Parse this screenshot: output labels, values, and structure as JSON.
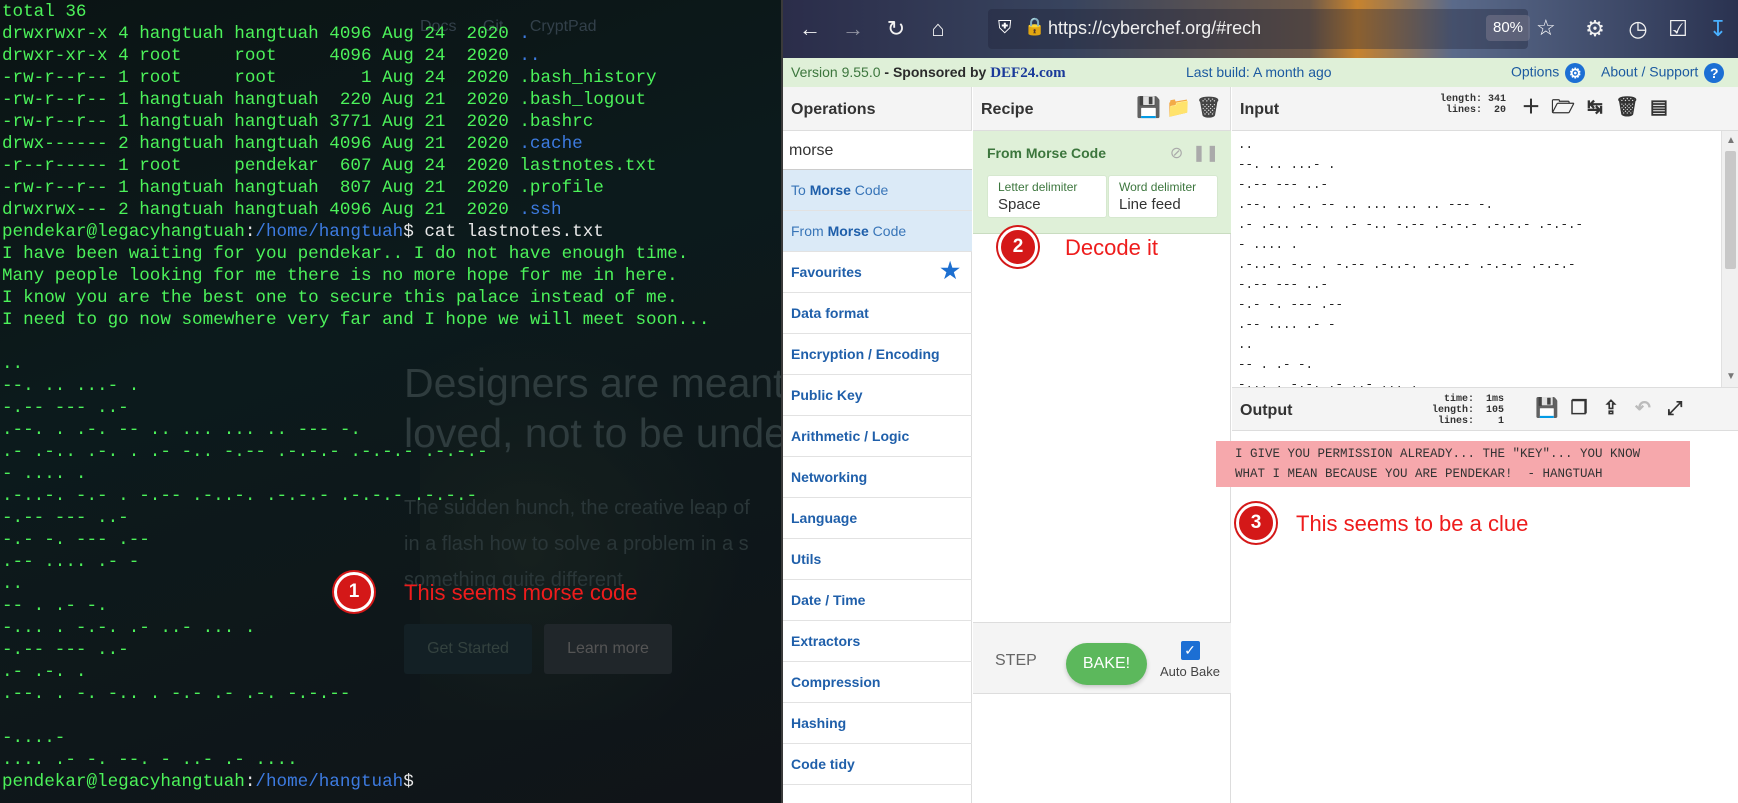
{
  "terminal": {
    "lines": [
      [
        {
          "t": "total 36",
          "c": "c-green"
        }
      ],
      [
        {
          "t": "drwxrwxr-x 4 hangtuah hangtuah 4096 Aug 24  2020 ",
          "c": "c-green"
        },
        {
          "t": ".",
          "c": "c-blue"
        }
      ],
      [
        {
          "t": "drwxr-xr-x 4 root     root     4096 Aug 24  2020 ",
          "c": "c-green"
        },
        {
          "t": "..",
          "c": "c-blue"
        }
      ],
      [
        {
          "t": "-rw-r--r-- 1 root     root        1 Aug 24  2020 .bash_history",
          "c": "c-green"
        }
      ],
      [
        {
          "t": "-rw-r--r-- 1 hangtuah hangtuah  220 Aug 21  2020 .bash_logout",
          "c": "c-green"
        }
      ],
      [
        {
          "t": "-rw-r--r-- 1 hangtuah hangtuah 3771 Aug 21  2020 .bashrc",
          "c": "c-green"
        }
      ],
      [
        {
          "t": "drwx------ 2 hangtuah hangtuah 4096 Aug 21  2020 ",
          "c": "c-green"
        },
        {
          "t": ".cache",
          "c": "c-blue"
        }
      ],
      [
        {
          "t": "-r--r----- 1 root     pendekar  607 Aug 24  2020 lastnotes.txt",
          "c": "c-green"
        }
      ],
      [
        {
          "t": "-rw-r--r-- 1 hangtuah hangtuah  807 Aug 21  2020 .profile",
          "c": "c-green"
        }
      ],
      [
        {
          "t": "drwxrwx--- 2 hangtuah hangtuah 4096 Aug 21  2020 ",
          "c": "c-green"
        },
        {
          "t": ".ssh",
          "c": "c-blue"
        }
      ],
      [
        {
          "t": "pendekar@legacyhangtuah",
          "c": "c-green"
        },
        {
          "t": ":",
          "c": "c-white"
        },
        {
          "t": "/home/hangtuah",
          "c": "c-blue"
        },
        {
          "t": "$ cat lastnotes.txt",
          "c": "c-white"
        }
      ],
      [
        {
          "t": "I have been waiting for you pendekar.. I do not have enough time.",
          "c": "c-green"
        }
      ],
      [
        {
          "t": "Many people looking for me there is no more hope for me in here.",
          "c": "c-green"
        }
      ],
      [
        {
          "t": "I know you are the best one to secure this palace instead of me.",
          "c": "c-green"
        }
      ],
      [
        {
          "t": "I need to go now somewhere very far and I hope we will meet soon...",
          "c": "c-green"
        }
      ],
      [
        {
          "t": "",
          "c": "c-green"
        }
      ],
      [
        {
          "t": "..",
          "c": "c-green"
        }
      ],
      [
        {
          "t": "--. .. ...- .",
          "c": "c-green"
        }
      ],
      [
        {
          "t": "-.-- --- ..-",
          "c": "c-green"
        }
      ],
      [
        {
          "t": ".--. . .-. -- .. ... ... .. --- -.",
          "c": "c-green"
        }
      ],
      [
        {
          "t": ".- .-.. .-. . .- -.. -.-- .-.-.- .-.-.- .-.-.-",
          "c": "c-green"
        }
      ],
      [
        {
          "t": "- .... .",
          "c": "c-green"
        }
      ],
      [
        {
          "t": ".-..-. -.- . -.-- .-..-. .-.-.- .-.-.- .-.-.-",
          "c": "c-green"
        }
      ],
      [
        {
          "t": "-.-- --- ..-",
          "c": "c-green"
        }
      ],
      [
        {
          "t": "-.- -. --- .--",
          "c": "c-green"
        }
      ],
      [
        {
          "t": ".-- .... .- -",
          "c": "c-green"
        }
      ],
      [
        {
          "t": "..",
          "c": "c-green"
        }
      ],
      [
        {
          "t": "-- . .- -.",
          "c": "c-green"
        }
      ],
      [
        {
          "t": "-... . -.-. .- ..- ... .",
          "c": "c-green"
        }
      ],
      [
        {
          "t": "-.-- --- ..-",
          "c": "c-green"
        }
      ],
      [
        {
          "t": ".- .-. .",
          "c": "c-green"
        }
      ],
      [
        {
          "t": ".--. . -. -.. . -.- .- .-. -.-.--",
          "c": "c-green"
        }
      ],
      [
        {
          "t": "",
          "c": "c-green"
        }
      ],
      [
        {
          "t": "-....-",
          "c": "c-green"
        }
      ],
      [
        {
          "t": ".... .- -. --. - ..- .- ....",
          "c": "c-green"
        }
      ],
      [
        {
          "t": "pendekar@legacyhangtuah",
          "c": "c-green"
        },
        {
          "t": ":",
          "c": "c-white"
        },
        {
          "t": "/home/hangtuah",
          "c": "c-blue"
        },
        {
          "t": "$ ",
          "c": "c-white"
        }
      ]
    ],
    "background": {
      "nav": [
        "Docs",
        "Git",
        "CryptPad"
      ],
      "headline_1": "Designers are meant t",
      "headline_2": "loved, not to be unders",
      "para_1": "The sudden hunch, the creative leap of",
      "para_2": "in a flash how to solve a problem in a s",
      "para_3": "something quite different",
      "btn_start": "Get Started",
      "btn_learn": "Learn more"
    },
    "annotation": {
      "number": "1",
      "text": "This seems morse code"
    }
  },
  "browser": {
    "url": "https://cyberchef.org/#rech",
    "zoom": "80%",
    "icons": {
      "back": "back-arrow-icon",
      "forward": "forward-arrow-icon",
      "reload": "reload-icon",
      "home": "home-icon",
      "shield": "shield-icon",
      "lock": "lock-icon",
      "star": "bookmark-star-icon"
    }
  },
  "cyberchef": {
    "version": "Version 9.55.0",
    "sponsor_prefix": " - Sponsored by ",
    "sponsor": "DEF24.com",
    "build": "Last build: A month ago",
    "options": "Options",
    "about": "About / Support",
    "operations": {
      "title": "Operations",
      "search_value": "morse",
      "results": [
        {
          "pre": "To ",
          "bold": "Morse",
          "post": " Code"
        },
        {
          "pre": "From ",
          "bold": "Morse",
          "post": " Code"
        }
      ],
      "categories": [
        "Favourites",
        "Data format",
        "Encryption / Encoding",
        "Public Key",
        "Arithmetic / Logic",
        "Networking",
        "Language",
        "Utils",
        "Date / Time",
        "Extractors",
        "Compression",
        "Hashing",
        "Code tidy"
      ]
    },
    "recipe": {
      "title": "Recipe",
      "op_title": "From Morse Code",
      "letter_delim_label": "Letter delimiter",
      "letter_delim_value": "Space",
      "word_delim_label": "Word delimiter",
      "word_delim_value": "Line feed",
      "step": "STEP",
      "bake": "BAKE!",
      "auto_bake": "Auto Bake",
      "annotation": {
        "number": "2",
        "text": "Decode it"
      }
    },
    "input": {
      "title": "Input",
      "meta": "length: 341\n lines:  20",
      "text": "..\n--. .. ...- .\n-.-- --- ..-\n.--. . .-. -- .. ... ... .. --- -.\n.- .-.. .-. . .- -.. -.-- .-.-.- .-.-.- .-.-.-\n- .... .\n.-..-. -.- . -.-- .-..-. .-.-.- .-.-.- .-.-.-\n-.-- --- ..-\n-.- -. --- .--\n.-- .... .- -\n..\n-- . .- -.\n-... . -.-. .- ..- ... ."
    },
    "output": {
      "title": "Output",
      "meta": "  time:  1ms\nlength:  105\n lines:    1",
      "text": "I GIVE YOU PERMISSION ALREADY... THE \"KEY\"... YOU KNOW\nWHAT I MEAN BECAUSE YOU ARE PENDEKAR!  - HANGTUAH",
      "annotation": {
        "number": "3",
        "text": "This seems to be a clue"
      }
    }
  }
}
